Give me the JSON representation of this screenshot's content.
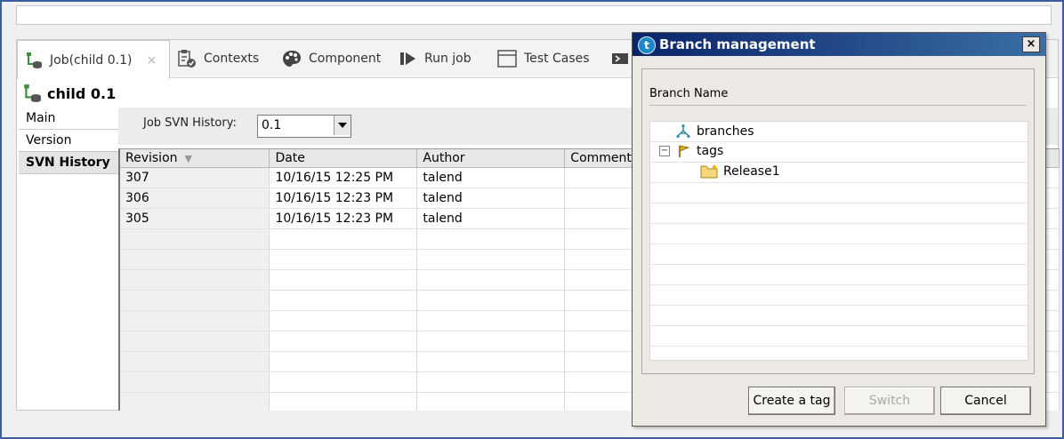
{
  "tabs": [
    {
      "label": "Job(child 0.1)",
      "icon": "job-icon",
      "close": "×"
    },
    {
      "label": "Contexts",
      "icon": "contexts-icon"
    },
    {
      "label": "Component",
      "icon": "component-icon"
    },
    {
      "label": "Run job",
      "icon": "run-job-icon"
    },
    {
      "label": "Test Cases",
      "icon": "test-cases-icon"
    }
  ],
  "job_title": "child 0.1",
  "nav": [
    "Main",
    "Version",
    "SVN History"
  ],
  "history": {
    "filter_label": "Job SVN History:",
    "version_value": "0.1",
    "columns": [
      "Revision",
      "Date",
      "Author",
      "Comment"
    ],
    "rows": [
      {
        "revision": "307",
        "date": "10/16/15 12:25 PM",
        "author": "talend",
        "comment": ""
      },
      {
        "revision": "306",
        "date": "10/16/15 12:23 PM",
        "author": "talend",
        "comment": ""
      },
      {
        "revision": "305",
        "date": "10/16/15 12:23 PM",
        "author": "talend",
        "comment": ""
      }
    ]
  },
  "dialog": {
    "icon_letter": "t",
    "title": "Branch management",
    "close_glyph": "×",
    "branch_name_label": "Branch Name",
    "tree": [
      {
        "label": "branches",
        "icon": "branches-icon"
      },
      {
        "label": "tags",
        "icon": "tag-flag-icon",
        "expander": "−"
      },
      {
        "label": "Release1",
        "icon": "folder-icon"
      }
    ],
    "buttons": {
      "create_tag": "Create a tag",
      "switch": "Switch",
      "cancel": "Cancel"
    }
  },
  "colors": {
    "title_bar_start": "#0a246a",
    "title_bar_end": "#3a6ea5",
    "frame_border": "#3b5f9e"
  }
}
